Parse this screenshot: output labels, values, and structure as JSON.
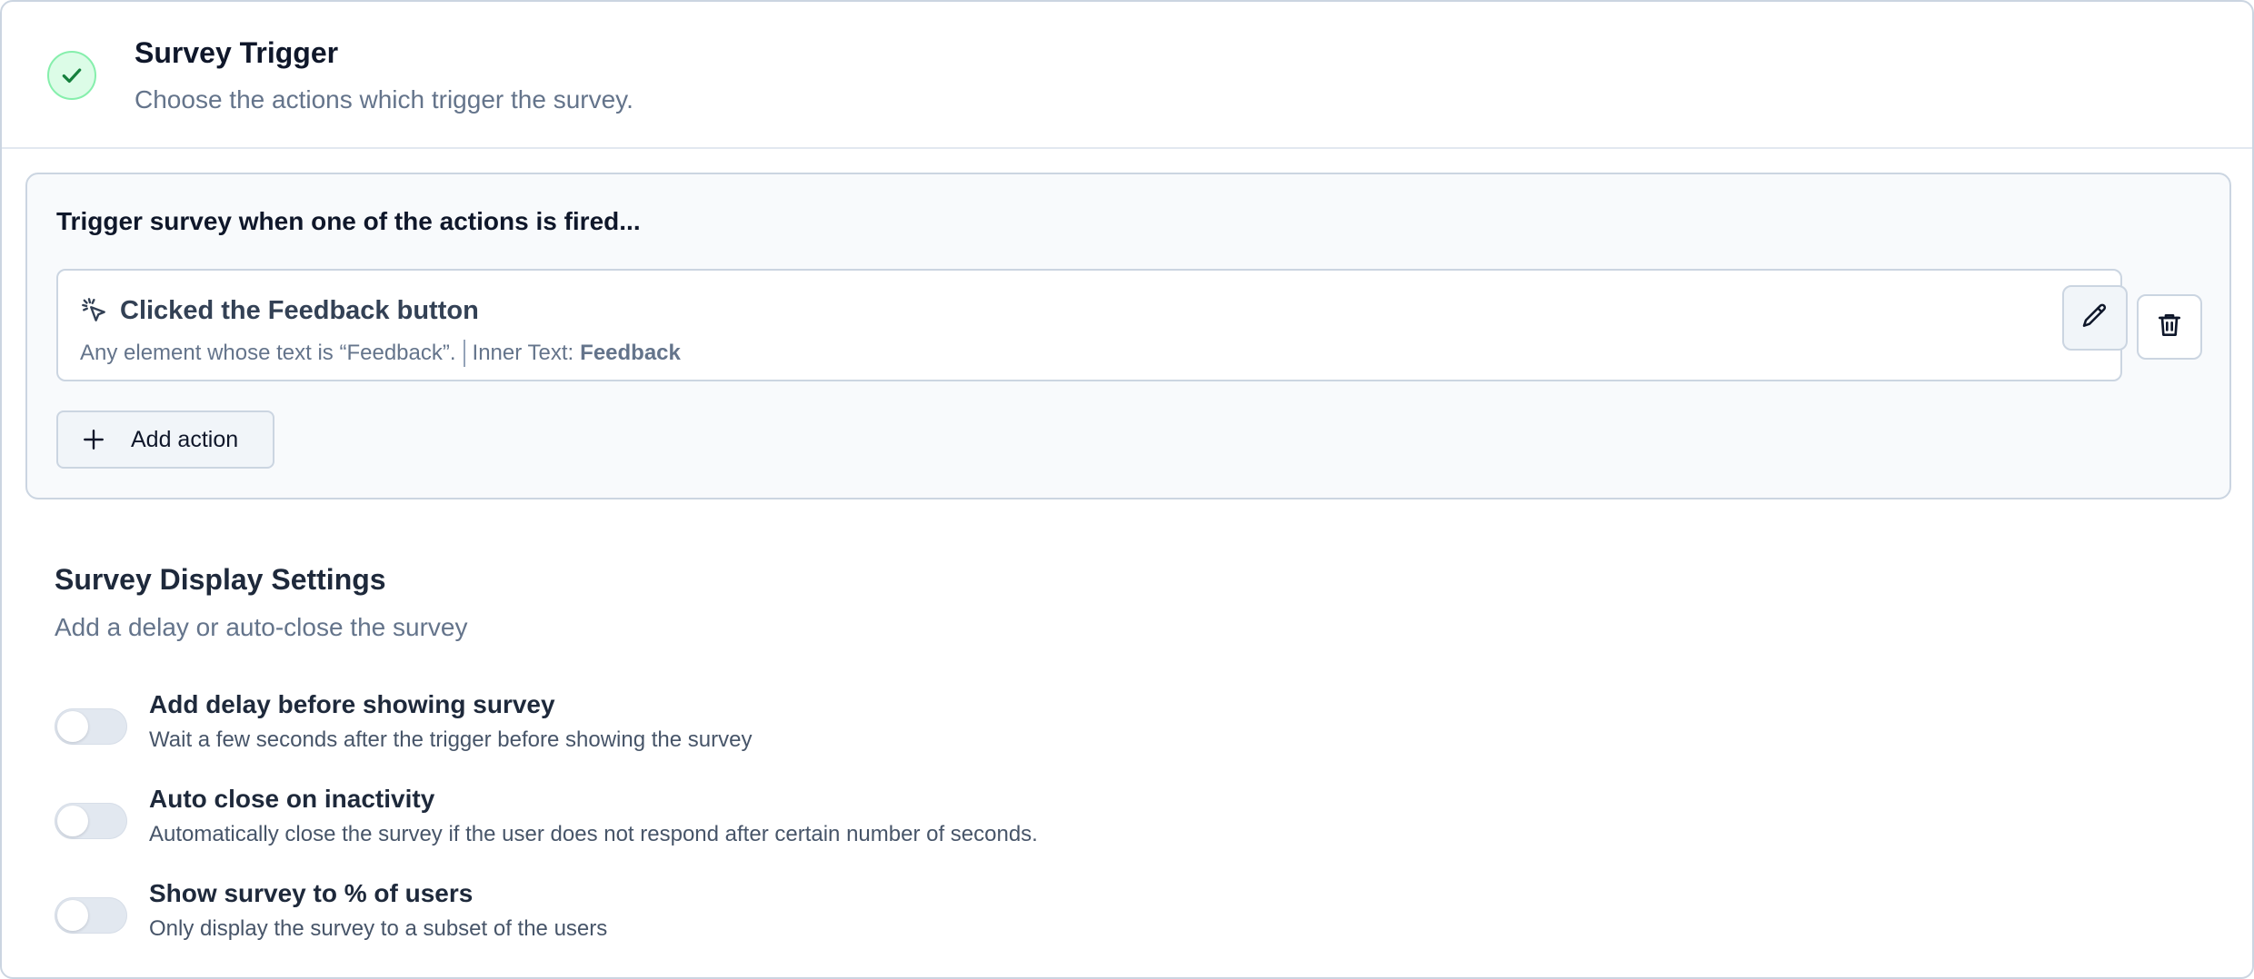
{
  "trigger_section": {
    "title": "Survey Trigger",
    "subtitle": "Choose the actions which trigger the survey.",
    "status_icon": "check-icon",
    "status_color": "#16a34a",
    "card": {
      "heading": "Trigger survey when one of the actions is fired...",
      "actions": [
        {
          "icon": "cursor-click-icon",
          "title": "Clicked the Feedback button",
          "description": "Any element whose text is “Feedback”.",
          "inner_text_label": "Inner Text:",
          "inner_text_value": "Feedback",
          "edit_icon": "pencil-icon",
          "delete_icon": "trash-icon"
        }
      ],
      "add_action_label": "Add action",
      "add_action_icon": "plus-icon"
    }
  },
  "display_section": {
    "title": "Survey Display Settings",
    "subtitle": "Add a delay or auto-close the survey",
    "settings": [
      {
        "title": "Add delay before showing survey",
        "description": "Wait a few seconds after the trigger before showing the survey",
        "enabled": false
      },
      {
        "title": "Auto close on inactivity",
        "description": "Automatically close the survey if the user does not respond after certain number of seconds.",
        "enabled": false
      },
      {
        "title": "Show survey to % of users",
        "description": "Only display the survey to a subset of the users",
        "enabled": false
      }
    ]
  }
}
